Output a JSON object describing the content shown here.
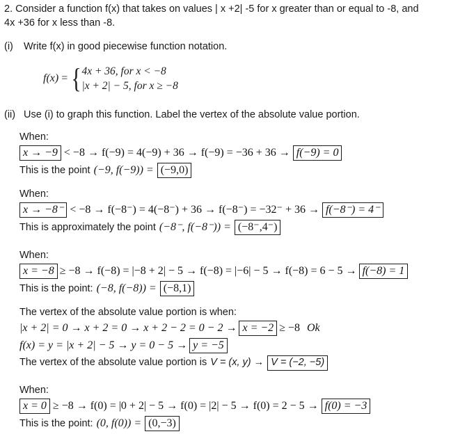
{
  "question": {
    "number": "2.",
    "line1": "2. Consider a function f(x) that takes on values | x +2| -5 for x greater than or equal to -8, and",
    "line2": "4x +36 for x less than -8."
  },
  "part_i": {
    "marker": "(i)",
    "text": "Write f(x) in good piecewise function notation.",
    "fx_label": "f(x)",
    "equals": "=",
    "case1": "4x + 36, for x < −8",
    "case2": "|x + 2| − 5, for x ≥ −8"
  },
  "part_ii": {
    "marker": "(ii)",
    "text": "Use (i) to graph this function. Label the vertex of the absolute value portion."
  },
  "blocks": [
    {
      "when_label": "When:",
      "boxed_condition": "x → −9",
      "work": "< −8 → f(−9) = 4(−9) + 36 → f(−9) = −36 + 36 →",
      "boxed_result": "f(−9) = 0",
      "conclusion_prefix": "This is the point",
      "conclusion_math": "(−9, f(−9)) =",
      "boxed_point": "(−9,0)"
    },
    {
      "when_label": "When:",
      "boxed_condition": "x → −8⁻",
      "work": "< −8 → f(−8⁻) = 4(−8⁻) + 36 → f(−8⁻) = −32⁻ + 36 →",
      "boxed_result": "f(−8⁻) = 4⁻",
      "conclusion_prefix": "This is approximately the point",
      "conclusion_math": "(−8⁻, f(−8⁻)) =",
      "boxed_point": "(−8⁻,4⁻)"
    },
    {
      "when_label": "When:",
      "boxed_condition": "x = −8",
      "work": "≥ −8 → f(−8) = |−8 + 2| − 5 → f(−8) = |−6| − 5 → f(−8) = 6 − 5 →",
      "boxed_result": "f(−8) = 1",
      "conclusion_prefix": "This is the point:",
      "conclusion_math": "(−8, f(−8)) =",
      "boxed_point": "(−8,1)"
    },
    {
      "when_label": "When:",
      "boxed_condition": "x = 0",
      "work": "≥ −8 → f(0) = |0 + 2| − 5 → f(0) = |2| − 5 → f(0) = 2 − 5 →",
      "boxed_result": "f(0) = −3",
      "conclusion_prefix": "This is the point:",
      "conclusion_math": "(0, f(0)) =",
      "boxed_point": "(0,−3)"
    }
  ],
  "vertex": {
    "heading": "The vertex of the absolute value portion is when:",
    "line2_work": "|x + 2| = 0 → x + 2 = 0 → x + 2 − 2 = 0 − 2 →",
    "line2_boxed": "x = −2",
    "line2_tail": "≥ −8",
    "line2_ok": "Ok",
    "line3_work": "f(x) = y = |x + 2| − 5 → y = 0 − 5 →",
    "line3_boxed": "y = −5",
    "line4_prefix": "The vertex of the absolute value portion is",
    "line4_math": "V = (x, y) →",
    "line4_boxed": "V = (−2, −5)"
  }
}
